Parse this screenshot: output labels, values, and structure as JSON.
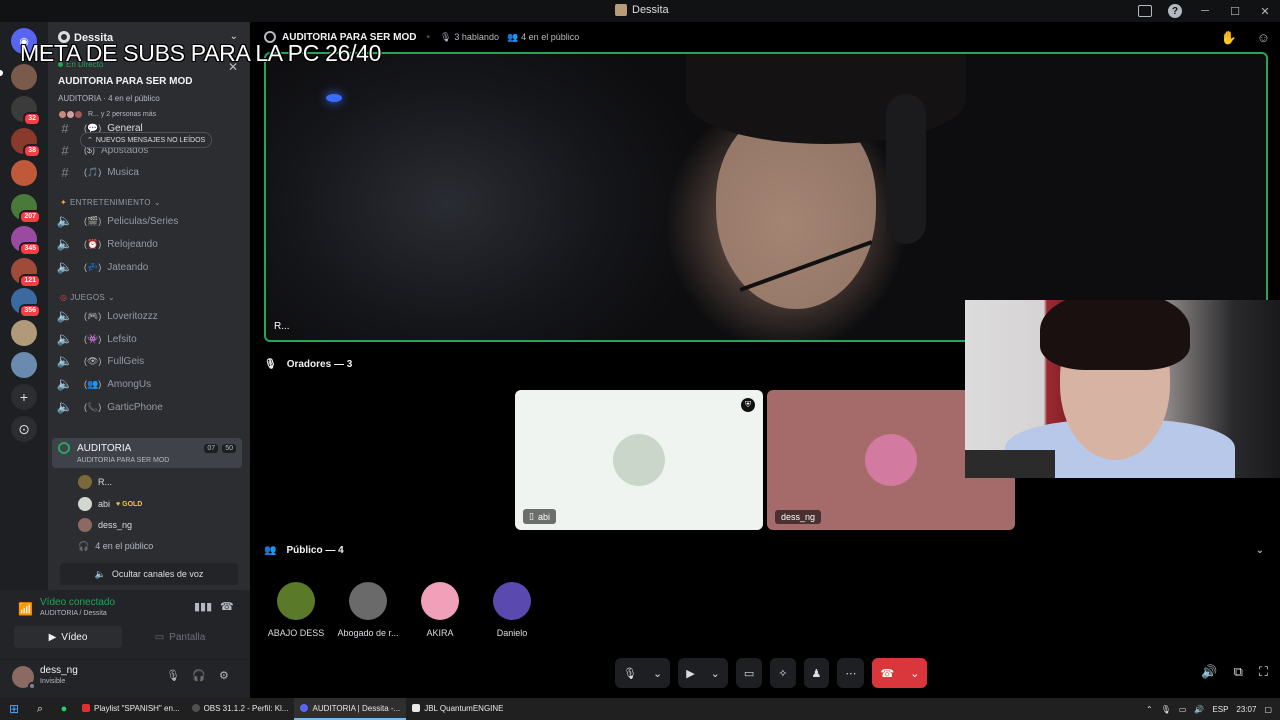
{
  "window": {
    "title": "Dessita"
  },
  "overlay": {
    "subs_goal": "META DE SUBS PARA LA PC 26/40"
  },
  "rail": {
    "badges": [
      "32",
      "38",
      "207",
      "345",
      "121",
      "356"
    ],
    "add_server": "+",
    "discover": "⊙"
  },
  "server": {
    "name": "Dessita",
    "live_label": "En Directo",
    "stage_title": "AUDITORIA PARA SER MOD",
    "stage_meta": "AUDITORIA · 4 en el público",
    "stage_people": "R... y 2 personas más",
    "unread_pill": "NUEVOS MENSAJES NO LEÍDOS"
  },
  "channels": {
    "general": "General",
    "apostados": "Apostados",
    "musica": "Musica",
    "cat_entretenimiento": "ENTRETENIMIENTO",
    "peliculas": "Peliculas/Series",
    "relojeando": "Relojeando",
    "jateando": "Jateando",
    "cat_juegos": "JUEGOS",
    "loveritozzz": "Loveritozzz",
    "lefsito": "Lefsito",
    "fullgeis": "FullGeis",
    "amongus": "AmongUs",
    "garticphone": "GarticPhone"
  },
  "voice_channel": {
    "name": "AUDITORIA",
    "subtitle": "AUDITORIA PARA SER MOD",
    "count_a": "07",
    "count_b": "50",
    "users": [
      "R...",
      "abi",
      "dess_ng"
    ],
    "gold_label": "GOLD",
    "audience_count": "4 en el público",
    "hide_label": "Ocultar canales de voz"
  },
  "voice_connection": {
    "status": "Vídeo conectado",
    "location": "AUDITORIA / Dessita",
    "video_tab": "Vídeo",
    "screen_tab": "Pantalla"
  },
  "user": {
    "name": "dess_ng",
    "status": "Invisible"
  },
  "stage": {
    "title": "AUDITORIA PARA SER MOD",
    "speaking": "3 hablando",
    "audience": "4 en el público",
    "main_tile_name": "R...",
    "speakers_header": "Oradores — 3",
    "speakers": [
      {
        "name": "abi"
      },
      {
        "name": "dess_ng"
      }
    ],
    "audience_header": "Público — 4",
    "audience_members": [
      "ABAJO DESS",
      "Abogado de r...",
      "AKIRA",
      "Danielo"
    ]
  },
  "taskbar": {
    "apps": [
      "Playlist \"SPANISH\" en...",
      "OBS 31.1.2 - Perfil: Kl...",
      "AUDITORIA | Dessita -...",
      "JBL QuantumENGINE"
    ],
    "lang": "ESP",
    "time": "23:07"
  },
  "colors": {
    "accent_green": "#23a55a",
    "danger_red": "#da373c",
    "sidebar_bg": "#2b2d31",
    "rail_bg": "#1e1f22"
  }
}
